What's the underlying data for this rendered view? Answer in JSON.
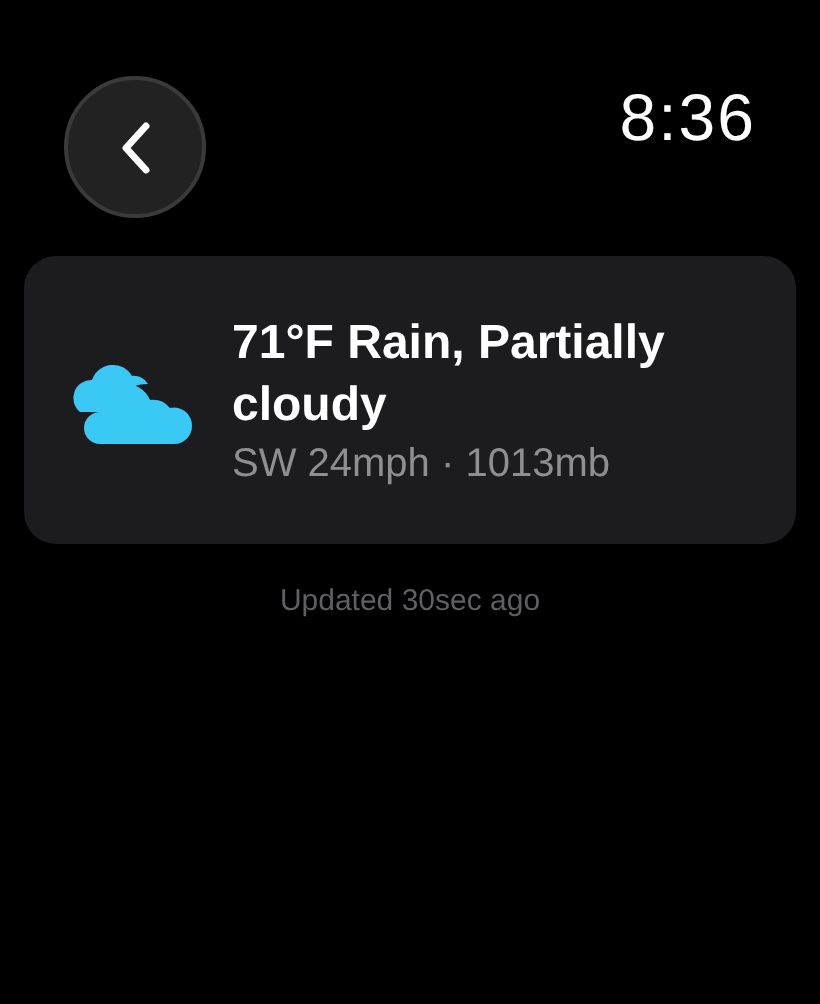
{
  "header": {
    "time": "8:36"
  },
  "weather": {
    "summary": "71°F Rain, Partially cloudy",
    "details": "SW 24mph · 1013mb"
  },
  "status": "Updated 30sec ago"
}
